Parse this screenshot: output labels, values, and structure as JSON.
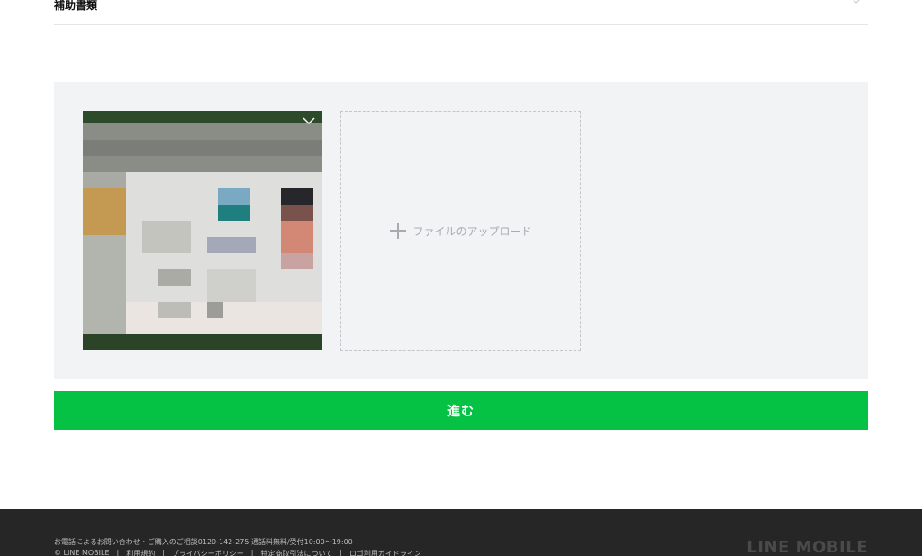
{
  "section": {
    "title": "補助書類",
    "icon": "chevron-down-icon"
  },
  "upload": {
    "label": "ファイルのアップロード",
    "plus_icon": "plus-icon",
    "thumbnail_icon": "chevron-down-icon"
  },
  "actions": {
    "proceed_label": "進む",
    "accent_color": "#06c244"
  },
  "footer": {
    "contact": "お電話によるお問い合わせ・ご購入のご相談0120-142-275 通話料無料/受付10:00〜19:00",
    "links": [
      "© LINE MOBILE",
      "利用規約",
      "プライバシーポリシー",
      "特定商取引法について",
      "ロゴ利用ガイドライン"
    ],
    "separator": "|",
    "logo": "LINE MOBILE"
  },
  "colors": {
    "panel_bg": "#f2f3f5",
    "footer_bg": "#262626"
  }
}
